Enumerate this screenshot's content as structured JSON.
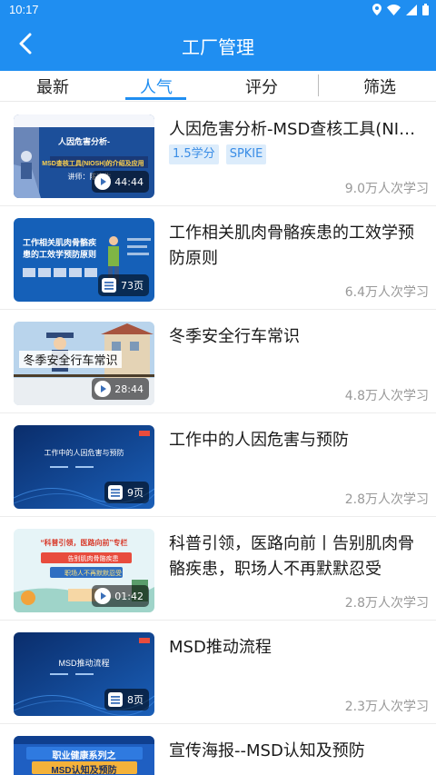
{
  "status": {
    "time": "10:17"
  },
  "header": {
    "title": "工厂管理"
  },
  "tabs": [
    {
      "label": "最新"
    },
    {
      "label": "人气"
    },
    {
      "label": "评分"
    },
    {
      "label": "筛选"
    }
  ],
  "items": [
    {
      "title": "人因危害分析-MSD查核工具(NIOSH)的介绍及应用",
      "tags": [
        "1.5学分",
        "SPKIE"
      ],
      "badge_type": "video",
      "badge": "44:44",
      "count": "9.0万人次学习",
      "thumb_lines": [
        "人因危害分析-",
        "MSD查核工具(NIOSH)的介绍及应用",
        "讲师：陈官生"
      ]
    },
    {
      "title": "工作相关肌肉骨骼疾患的工效学预防原则",
      "badge_type": "doc",
      "badge": "73页",
      "count": "6.4万人次学习",
      "thumb_lines": [
        "工作相关肌肉骨骼疾",
        "患的工效学预防原则"
      ]
    },
    {
      "title": "冬季安全行车常识",
      "badge_type": "video",
      "badge": "28:44",
      "count": "4.8万人次学习",
      "thumb_lines": [
        "冬季安全行车常识"
      ]
    },
    {
      "title": "工作中的人因危害与预防",
      "badge_type": "doc",
      "badge": "9页",
      "count": "2.8万人次学习",
      "thumb_lines": [
        "工作中的人因危害与预防"
      ]
    },
    {
      "title": "科普引领，医路向前丨告别肌肉骨骼疾患，职场人不再默默忍受",
      "badge_type": "video",
      "badge": "01:42",
      "count": "2.8万人次学习",
      "thumb_lines": [
        "“科普引领，医路向前”专栏",
        "告别肌肉骨骼疾患",
        "职场人不再默默忍受"
      ]
    },
    {
      "title": "MSD推动流程",
      "badge_type": "doc",
      "badge": "8页",
      "count": "2.3万人次学习",
      "thumb_lines": [
        "MSD推动流程"
      ]
    },
    {
      "title": "宣传海报--MSD认知及预防",
      "thumb_lines": [
        "职业健康系列之",
        "MSD认知及预防"
      ]
    }
  ],
  "colors": {
    "primary": "#1f8ef1",
    "tag_bg": "#dcecfb",
    "tag_text": "#3a8de6",
    "muted_text": "#999999"
  },
  "icons": {
    "back": "back-arrow-icon",
    "video": "play-icon",
    "doc": "document-icon"
  }
}
